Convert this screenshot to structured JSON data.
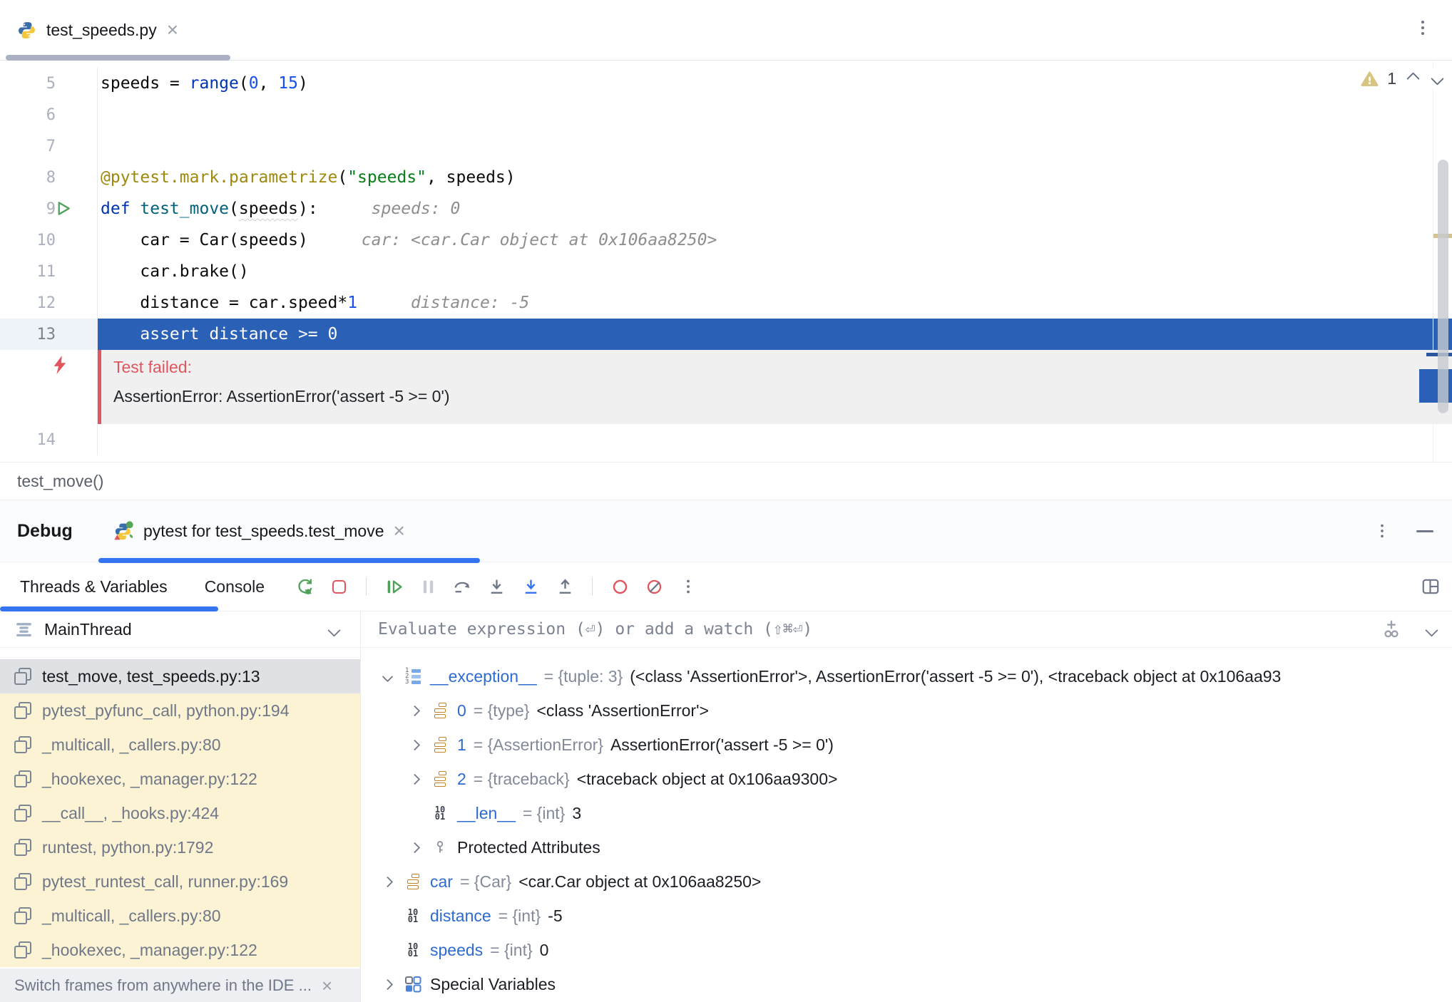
{
  "editor_tab": {
    "title": "test_speeds.py"
  },
  "editor": {
    "warning_count": "1",
    "lines": [
      {
        "num": "5",
        "tokens": [
          [
            "speeds = ",
            "pl"
          ],
          [
            "range",
            "kw"
          ],
          [
            "(",
            "pl"
          ],
          [
            "0",
            "num"
          ],
          [
            ", ",
            "pl"
          ],
          [
            "15",
            "num"
          ],
          [
            ")",
            "pl"
          ]
        ]
      },
      {
        "num": "6",
        "tokens": []
      },
      {
        "num": "7",
        "tokens": []
      },
      {
        "num": "8",
        "tokens": [
          [
            "@pytest.mark.parametrize",
            "deco"
          ],
          [
            "(",
            "pl"
          ],
          [
            "\"speeds\"",
            "str"
          ],
          [
            ", speeds)",
            "pl"
          ]
        ]
      },
      {
        "num": "9",
        "gutter": "run",
        "tokens": [
          [
            "def ",
            "kw"
          ],
          [
            "test_move",
            "fn"
          ],
          [
            "(",
            "pl"
          ],
          [
            "speeds",
            "warn"
          ],
          [
            "):",
            "pl"
          ]
        ],
        "hint": "speeds: 0"
      },
      {
        "num": "10",
        "tokens": [
          [
            "    car = Car(speeds)",
            "pl"
          ]
        ],
        "hint": "car: <car.Car object at 0x106aa8250>"
      },
      {
        "num": "11",
        "tokens": [
          [
            "    car.brake()",
            "pl"
          ]
        ]
      },
      {
        "num": "12",
        "tokens": [
          [
            "    distance = car.speed*",
            "pl"
          ],
          [
            "1",
            "num"
          ]
        ],
        "hint": "distance: -5"
      },
      {
        "num": "13",
        "exec": true,
        "tokens": [
          [
            "    assert distance >= 0",
            "pl"
          ]
        ]
      },
      {
        "type": "inlay",
        "title": "Test failed:",
        "message": "AssertionError: AssertionError('assert -5 >= 0')"
      },
      {
        "num": "14",
        "tokens": []
      }
    ]
  },
  "breadcrumb": {
    "label": "test_move()"
  },
  "debug": {
    "panel_label": "Debug",
    "run_tab": {
      "label": "pytest for test_speeds.test_move"
    },
    "tabs": [
      {
        "label": "Threads & Variables",
        "active": true
      },
      {
        "label": "Console",
        "active": false
      }
    ],
    "threads": {
      "selected": "MainThread"
    },
    "frames": [
      "test_move, test_speeds.py:13",
      "pytest_pyfunc_call, python.py:194",
      "_multicall, _callers.py:80",
      "_hookexec, _manager.py:122",
      "__call__, _hooks.py:424",
      "runtest, python.py:1792",
      "pytest_runtest_call, runner.py:169",
      "_multicall, _callers.py:80",
      "_hookexec, _manager.py:122"
    ],
    "frames_banner": {
      "text": "Switch frames from anywhere in the IDE ..."
    },
    "evaluate": {
      "placeholder": "Evaluate expression (⏎) or add a watch (⇧⌘⏎)"
    },
    "variables": [
      {
        "ind": 0,
        "chev": "down",
        "icon": "tuple",
        "name": "__exception__",
        "meta": "= {tuple: 3}",
        "value": "(<class 'AssertionError'>, AssertionError('assert -5 >= 0'), <traceback object at 0x106aa93"
      },
      {
        "ind": 1,
        "chev": "right",
        "icon": "stack",
        "name": "0",
        "meta": "= {type}",
        "value": "<class 'AssertionError'>"
      },
      {
        "ind": 1,
        "chev": "right",
        "icon": "stack",
        "name": "1",
        "meta": "= {AssertionError}",
        "value": "AssertionError('assert -5 >= 0')"
      },
      {
        "ind": 1,
        "chev": "right",
        "icon": "stack",
        "name": "2",
        "meta": "= {traceback}",
        "value": "<traceback object at 0x106aa9300>"
      },
      {
        "ind": 1,
        "chev": "",
        "icon": "int",
        "name": "__len__",
        "meta": "= {int}",
        "value": "3"
      },
      {
        "ind": 1,
        "chev": "right",
        "icon": "key",
        "name": "Protected Attributes",
        "ns": "plain",
        "meta": "",
        "value": ""
      },
      {
        "ind": 0,
        "chev": "right",
        "icon": "stack",
        "name": "car",
        "meta": "= {Car}",
        "value": "<car.Car object at 0x106aa8250>"
      },
      {
        "ind": 0,
        "chev": "",
        "icon": "int",
        "name": "distance",
        "meta": "= {int}",
        "value": "-5"
      },
      {
        "ind": 0,
        "chev": "",
        "icon": "int",
        "name": "speeds",
        "meta": "= {int}",
        "value": "0"
      },
      {
        "ind": 0,
        "chev": "right",
        "icon": "grid",
        "name": "Special Variables",
        "ns": "plain",
        "meta": "",
        "value": ""
      }
    ]
  },
  "icons": {
    "close": "×",
    "minimize": "—",
    "kebab-menu": "⋮",
    "python": "python-logo",
    "pytest": "pytest-logo",
    "warning": "khaki-triangle-exclamation",
    "run-test": "green-play-triangle",
    "test-failed-bolt": "red-lightning",
    "rerun-debug": "green-circular-arrow-bug",
    "stop": "red-square-outline",
    "resume": "green-bar-play",
    "pause": "gray-double-bar",
    "step-over": "arc-arrow",
    "step-into": "down-arrow-to-line",
    "force-step-into": "blue-down-arrow-to-line",
    "step-out": "up-arrow-from-line",
    "view-breakpoints": "red-circle",
    "mute-breakpoints": "red-circle-slash",
    "layout": "split-rectangle",
    "threads": "stacked-bars",
    "stack-frame": "double-square",
    "add-watch": "plus-over-glasses",
    "tuple": "numbered-list-123",
    "instance": "orange-stack",
    "int": "10-01-digits",
    "key": "key-glyph",
    "special-variables": "four-squares-grid"
  },
  "colors": {
    "accent_blue": "#3574f0",
    "exec_line_blue": "#2b60b7",
    "error_red": "#e0565e",
    "warning_khaki": "#d2c48c",
    "library_frame_bg": "#fcf3d4",
    "selected_frame_bg": "#dfe1e5",
    "keyword": "#0033b3",
    "function_name": "#00627a",
    "decorator": "#9e880d",
    "string": "#067d17",
    "number": "#1750eb",
    "variable_name_blue": "#2e6bd0",
    "instance_icon_orange": "#bf8326"
  }
}
